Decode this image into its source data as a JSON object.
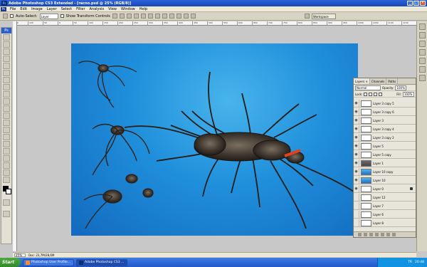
{
  "window": {
    "app_icon": "Ps",
    "title": "Adobe Photoshop CS3 Extended - [racno.psd @ 25% (RGB/8)]"
  },
  "menu": [
    "File",
    "Edit",
    "Image",
    "Layer",
    "Select",
    "Filter",
    "Analysis",
    "View",
    "Window",
    "Help"
  ],
  "options": {
    "auto_select_label": "Auto-Select:",
    "auto_select_value": "Layer",
    "transform_label": "Show Transform Controls",
    "workspace_label": "Workspace"
  },
  "ruler_ticks": [
    "150",
    "100",
    "50",
    "0",
    "50",
    "100",
    "150",
    "200",
    "250",
    "300",
    "350",
    "400",
    "450",
    "500",
    "550",
    "600",
    "650",
    "700",
    "750",
    "800",
    "850",
    "900",
    "950",
    "1000",
    "1050",
    "1100",
    "1150"
  ],
  "toolbox": {
    "logo": "Ps"
  },
  "layers_panel": {
    "tabs": [
      "Layers ×",
      "Channels",
      "Paths"
    ],
    "blend_mode": "Normal",
    "opacity_label": "Opacity:",
    "opacity_value": "100%",
    "lock_label": "Lock:",
    "fill_label": "Fill:",
    "fill_value": "100%",
    "layers": [
      {
        "name": "Layer 3 copy 5",
        "thumb": "white"
      },
      {
        "name": "Layer 3 copy 6",
        "thumb": "white"
      },
      {
        "name": "Layer 3",
        "thumb": "white"
      },
      {
        "name": "Layer 3 copy 4",
        "thumb": "white"
      },
      {
        "name": "Layer 3 copy 2",
        "thumb": "white"
      },
      {
        "name": "Layer 5",
        "thumb": "white"
      },
      {
        "name": "Layer 5 copy",
        "thumb": "white"
      },
      {
        "name": "Layer 1",
        "thumb": "gray"
      },
      {
        "name": "Layer 10 copy",
        "thumb": "blue"
      },
      {
        "name": "Layer 10",
        "thumb": "blue"
      },
      {
        "name": "Layer 0",
        "thumb": "white"
      },
      {
        "name": "Layer 12",
        "thumb": "white"
      },
      {
        "name": "Layer 7",
        "thumb": "white"
      },
      {
        "name": "Layer 6",
        "thumb": "white"
      },
      {
        "name": "Layer 8",
        "thumb": "white"
      }
    ]
  },
  "status": {
    "zoom": "25%",
    "doc": "Doc: 23,7M/28,6M"
  },
  "taskbar": {
    "start": "Start",
    "tasks": [
      "Photoshop User Profile...",
      "Adobe Photoshop CS3 ..."
    ],
    "lang": "TR",
    "clock": "20:48"
  },
  "colors": {
    "canvas_bg": "#1f8fdb",
    "titlebar": "#2657c8",
    "taskbar": "#2a5fd0"
  }
}
